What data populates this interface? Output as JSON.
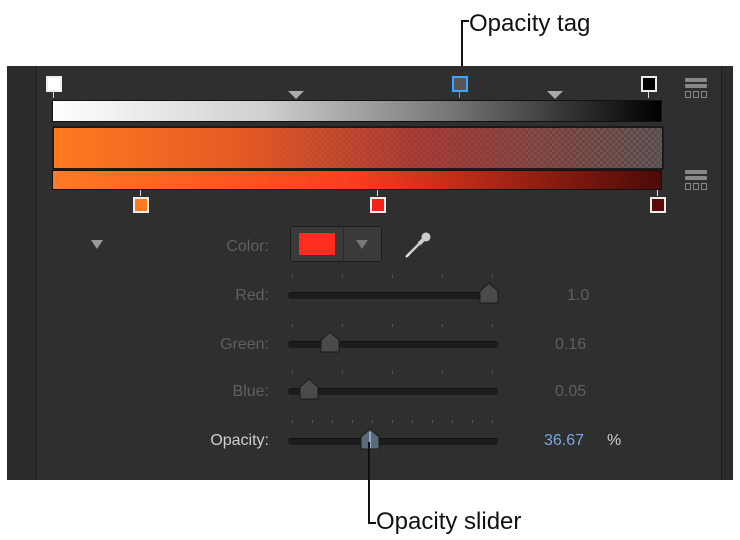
{
  "callouts": {
    "top": "Opacity tag",
    "bottom": "Opacity slider"
  },
  "gradient": {
    "opacity_tags": [
      "#ffffff",
      "#555555",
      "#000000"
    ],
    "selected_opacity_tag": 1,
    "color_tags": [
      "#ff7a1e",
      "#f2231c",
      "#5a0a08"
    ]
  },
  "controls": {
    "color_label": "Color:",
    "color_value": "#ff2d1f",
    "red_label": "Red:",
    "red_value": "1.0",
    "green_label": "Green:",
    "green_value": "0.16",
    "blue_label": "Blue:",
    "blue_value": "0.05",
    "opacity_label": "Opacity:",
    "opacity_value": "36.67",
    "opacity_unit": "%"
  },
  "icons": {
    "disclosure": "disclosure-triangle-icon",
    "eyedropper": "eyedropper-icon",
    "dropdown": "chevron-down-icon",
    "side": "gradient-preset-icon"
  }
}
